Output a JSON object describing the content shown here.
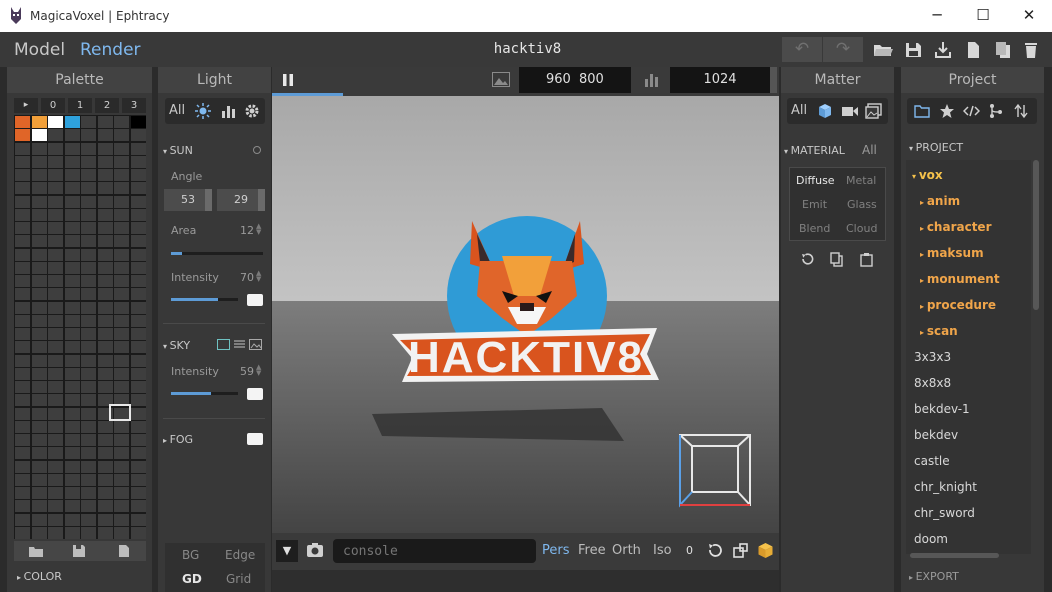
{
  "window": {
    "title": "MagicaVoxel | Ephtracy",
    "minimize": "─",
    "maximize": "☐",
    "close": "✕"
  },
  "header": {
    "model_tab": "Model",
    "render_tab": "Render",
    "filename": "hacktiv8",
    "undo": "↶",
    "redo": "↷"
  },
  "palette": {
    "title": "Palette",
    "tabs": [
      "▸",
      "0",
      "1",
      "2",
      "3"
    ],
    "colors": [
      "#e06528",
      "#f2a03a",
      "#ffffff",
      "#2ea1dc",
      "#000000"
    ],
    "second_row": [
      "#e06528",
      "#ffffff"
    ],
    "footer_label": "COLOR"
  },
  "light": {
    "title": "Light",
    "filter_all": "All",
    "sun_label": "SUN",
    "angle_label": "Angle",
    "angle_a": "53",
    "angle_b": "29",
    "area_label": "Area",
    "area_value": "12",
    "area_level": 0.12,
    "sun_intensity_label": "Intensity",
    "sun_intensity_value": "70",
    "sun_intensity_level": 0.7,
    "sky_label": "SKY",
    "sky_intensity_label": "Intensity",
    "sky_intensity_value": "59",
    "sky_intensity_level": 0.59,
    "fog_label": "FOG",
    "bg_label": "BG",
    "edge_label": "Edge",
    "gd_label": "GD",
    "grid_label": "Grid"
  },
  "viewport": {
    "width": "960",
    "height": "800",
    "samples": "1024",
    "banner_text": "HACKTIV8",
    "progress_level": 0.14
  },
  "console": {
    "placeholder": "console",
    "pers": "Pers",
    "free": "Free",
    "orth": "Orth",
    "iso": "Iso",
    "count": "0"
  },
  "matter": {
    "title": "Matter",
    "filter_all": "All",
    "material_label": "MATERIAL",
    "material_all": "All",
    "materials": [
      "Diffuse",
      "Metal",
      "Emit",
      "Glass",
      "Blend",
      "Cloud"
    ]
  },
  "project": {
    "title": "Project",
    "section_label": "PROJECT",
    "folder_root": "vox",
    "subfolders": [
      "anim",
      "character",
      "maksum",
      "monument",
      "procedure",
      "scan"
    ],
    "files": [
      "3x3x3",
      "8x8x8",
      "bekdev-1",
      "bekdev",
      "castle",
      "chr_knight",
      "chr_sword",
      "doom"
    ],
    "export_label": "EXPORT"
  }
}
